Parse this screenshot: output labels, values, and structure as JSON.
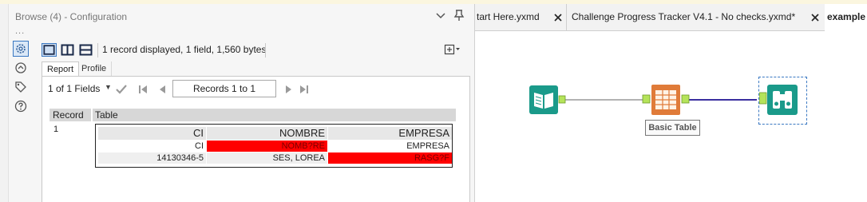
{
  "panel": {
    "title": "Browse (4) - Configuration",
    "dots": "...",
    "record_info": "1 record displayed, 1 field, 1,560 bytes",
    "tabs": {
      "report": "Report",
      "profile": "Profile"
    },
    "fields_select": "1 of 1 Fields",
    "records_range": "Records 1 to 1",
    "report": {
      "header_record": "Record",
      "header_table": "Table",
      "row_number": "1",
      "table": {
        "headers": [
          "CI",
          "NOMBRE",
          "EMPRESA"
        ],
        "row1": [
          "CI",
          "NOMB?RE",
          "EMPRESA"
        ],
        "row2": [
          "14130346-5",
          "SES, LOREA",
          "RASG?F"
        ]
      }
    }
  },
  "workflow": {
    "tabs": [
      {
        "label": "tart Here.yxmd"
      },
      {
        "label": "Challenge Progress Tracker V4.1 - No checks.yxmd*"
      },
      {
        "label": "example ("
      }
    ],
    "tool_label": "Basic Table"
  },
  "colors": {
    "error_cell": "#ff0000",
    "input_tool": "#1a9a8a",
    "table_tool": "#e07b39",
    "browse_tool": "#1a9a8a",
    "connection_primary": "#3b2fa0",
    "connection_secondary": "#999999"
  },
  "icons": {
    "configuration": "gear-icon",
    "annotation": "annotation-icon",
    "tag": "tag-icon",
    "help": "help-icon",
    "pin": "pin-icon",
    "chevron": "chevron-down-icon"
  }
}
